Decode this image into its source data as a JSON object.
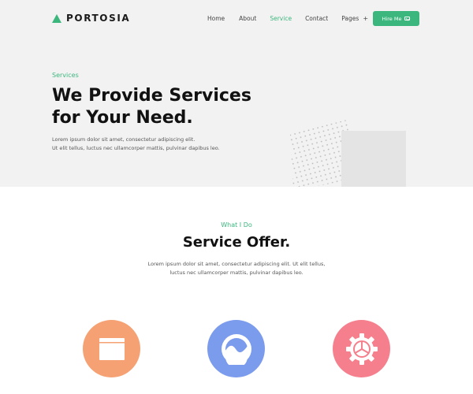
{
  "brand": {
    "name": "PORTOSIA",
    "accent": "#3bb77e"
  },
  "nav": {
    "items": [
      "Home",
      "About",
      "Service",
      "Contact",
      "Pages"
    ],
    "active": "Service",
    "pages_plus": "+"
  },
  "hire": {
    "label": "Hire Me",
    "icon": "mail-icon"
  },
  "hero": {
    "kicker": "Services",
    "title_line1": "We Provide Services",
    "title_line2": "for Your Need.",
    "desc_line1": "Lorem ipsum dolor sit amet, consectetur adipiscing elit.",
    "desc_line2": "Ut elit tellus, luctus nec ullamcorper mattis, pulvinar dapibus leo."
  },
  "services": {
    "kicker": "What I Do",
    "title": "Service Offer.",
    "desc_line1": "Lorem ipsum dolor sit amet, consectetur adipiscing elit. Ut elit tellus,",
    "desc_line2": "luctus nec ullamcorper mattis, pulvinar dapibus leo.",
    "icons": [
      {
        "name": "folder-icon",
        "color": "#f5a173"
      },
      {
        "name": "wave-image-icon",
        "color": "#7b9bec"
      },
      {
        "name": "gear-icon",
        "color": "#f57f8c"
      }
    ]
  }
}
